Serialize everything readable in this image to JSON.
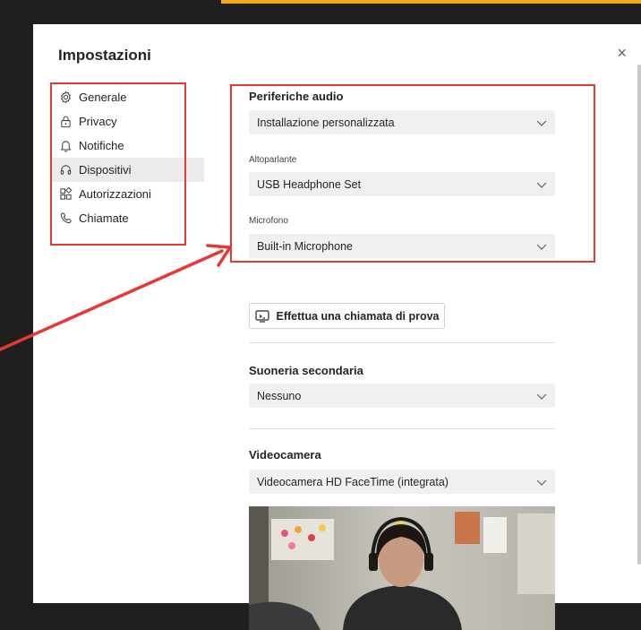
{
  "dialog": {
    "title": "Impostazioni",
    "close_glyph": "×"
  },
  "nav": {
    "items": [
      {
        "label": "Generale",
        "icon": "gear-icon"
      },
      {
        "label": "Privacy",
        "icon": "lock-icon"
      },
      {
        "label": "Notifiche",
        "icon": "bell-icon"
      },
      {
        "label": "Dispositivi",
        "icon": "headset-icon",
        "active": true
      },
      {
        "label": "Autorizzazioni",
        "icon": "apps-icon"
      },
      {
        "label": "Chiamate",
        "icon": "phone-icon"
      }
    ]
  },
  "audio": {
    "title": "Periferiche audio",
    "device_value": "Installazione personalizzata",
    "speaker_label": "Altoparlante",
    "speaker_value": "USB Headphone Set",
    "mic_label": "Microfono",
    "mic_value": "Built-in Microphone"
  },
  "test_call": {
    "label": "Effettua una chiamata di prova"
  },
  "ringer": {
    "title": "Suoneria secondaria",
    "value": "Nessuno"
  },
  "camera": {
    "title": "Videocamera",
    "value": "Videocamera HD FaceTime (integrata)"
  },
  "colors": {
    "annotation": "#e53935",
    "accent": "#f4a81d"
  }
}
